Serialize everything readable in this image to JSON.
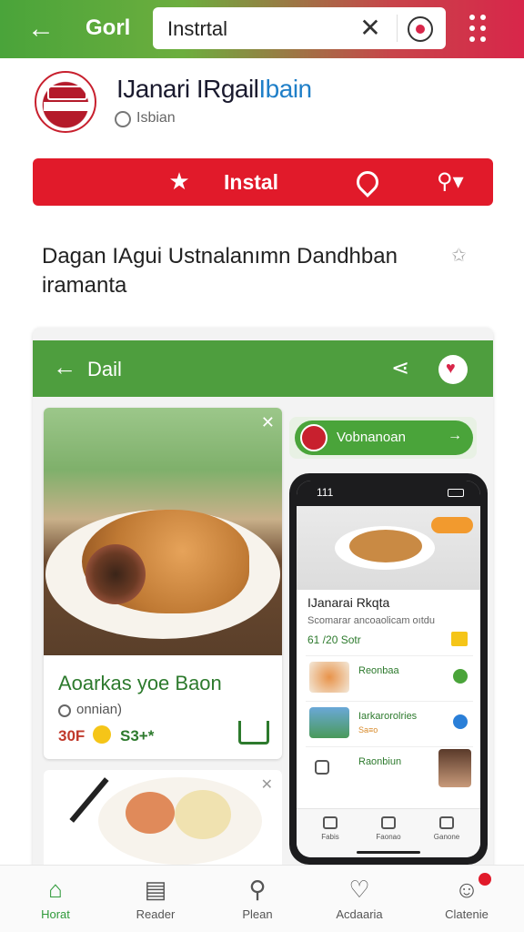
{
  "top_bar": {
    "app_short_name": "Gorl",
    "search_value": "Instrtal",
    "colors": {
      "gradient_start": "#4aa43a",
      "gradient_end": "#d8264a"
    }
  },
  "app": {
    "title_main": "IJanari IRgail",
    "title_accent": "Ibain",
    "developer": "Isbian"
  },
  "install_bar": {
    "label": "Instal",
    "color": "#e11a2a"
  },
  "description": "Dagan IAgui Ustnalanımn Dandhban iramanta",
  "screenshot": {
    "bar_title": "Dail",
    "bar_color": "#4e9e3e",
    "recipe_card": {
      "name": "Aoarkas yoe Baon",
      "time": "onnian)",
      "score": "30F",
      "count": "S3+*"
    },
    "promo": {
      "text": "Vobnanoan"
    },
    "phone": {
      "time": "111",
      "title": "IJanarai Rkqta",
      "subtitle": "Scomarar ancoaolicam oıtdu",
      "meta": "61 /20 Sotr",
      "rows": [
        {
          "label": "Reonbaa",
          "sub": ""
        },
        {
          "label": "Iarkarorolries",
          "sub": "Sa≡o"
        },
        {
          "label": "Raonbiun",
          "sub": ""
        }
      ],
      "nav": [
        "Fabis",
        "Faonao",
        "Ganone"
      ]
    }
  },
  "bottom_nav": [
    {
      "label": "Horat",
      "icon": "home-icon",
      "active": true
    },
    {
      "label": "Reader",
      "icon": "reader-icon",
      "active": false
    },
    {
      "label": "Plean",
      "icon": "search-icon",
      "active": false
    },
    {
      "label": "Acdaaria",
      "icon": "heart-icon",
      "active": false
    },
    {
      "label": "Clatenie",
      "icon": "chat-icon",
      "active": false
    }
  ]
}
